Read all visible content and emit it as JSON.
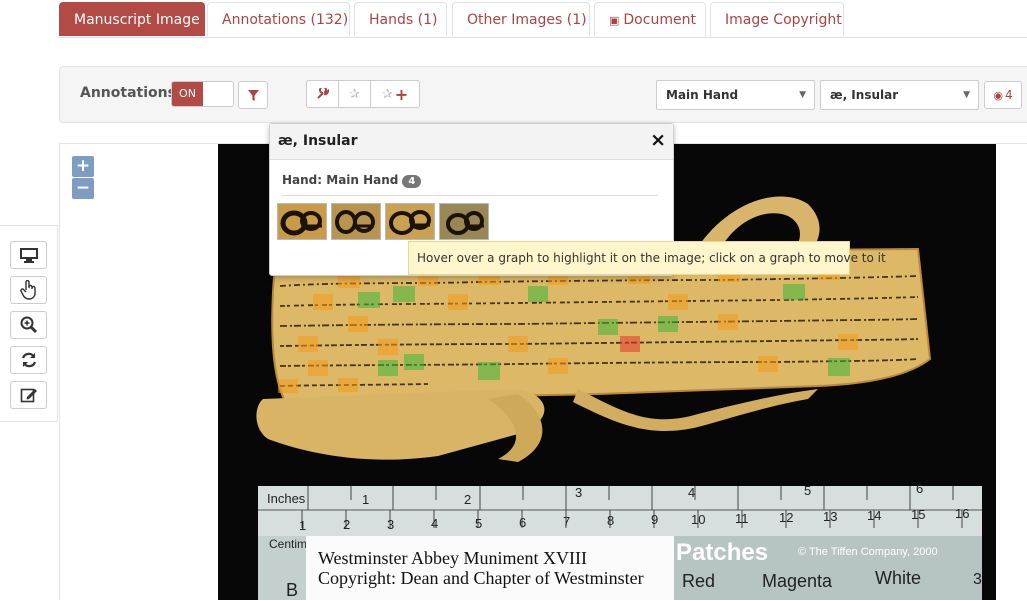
{
  "tabs": [
    {
      "label": "Manuscript Image"
    },
    {
      "label": "Annotations (132)"
    },
    {
      "label": "Hands (1)"
    },
    {
      "label": "Other Images (1)"
    },
    {
      "label": "Document"
    },
    {
      "label": "Image Copyright"
    }
  ],
  "toolbar": {
    "annotations_label": "Annotations",
    "toggle_on": "ON",
    "hand_select": "Main Hand",
    "allograph_select": "æ, Insular",
    "visible_count": "4"
  },
  "popup": {
    "title": "æ, Insular",
    "close": "×",
    "hand_label": "Hand: Main Hand",
    "hand_count": "4"
  },
  "tooltip": "Hover over a graph to highlight it on the image; click on a graph to move to it",
  "image": {
    "ruler_inches": "Inches",
    "ruler_cm": "Centimetres",
    "inch_marks": [
      "1",
      "2",
      "3",
      "4",
      "5",
      "6"
    ],
    "cm_marks": [
      "1",
      "2",
      "3",
      "4",
      "5",
      "6",
      "7",
      "8",
      "9",
      "10",
      "11",
      "12",
      "13",
      "14",
      "15",
      "16"
    ],
    "card_line1": "Westminster Abbey Muniment XVIII",
    "card_line2": "Copyright: Dean and Chapter of Westminster",
    "patches": "Patches",
    "tiffen": "© The Tiffen Company, 2000",
    "colors": [
      "Red",
      "Magenta",
      "White"
    ],
    "partial_b": "B",
    "partial_3": "3"
  },
  "colors": {
    "accent": "#b24a46",
    "highlight_green": "#3db83d",
    "highlight_orange": "#f59a1a",
    "highlight_red": "#e8342a"
  }
}
